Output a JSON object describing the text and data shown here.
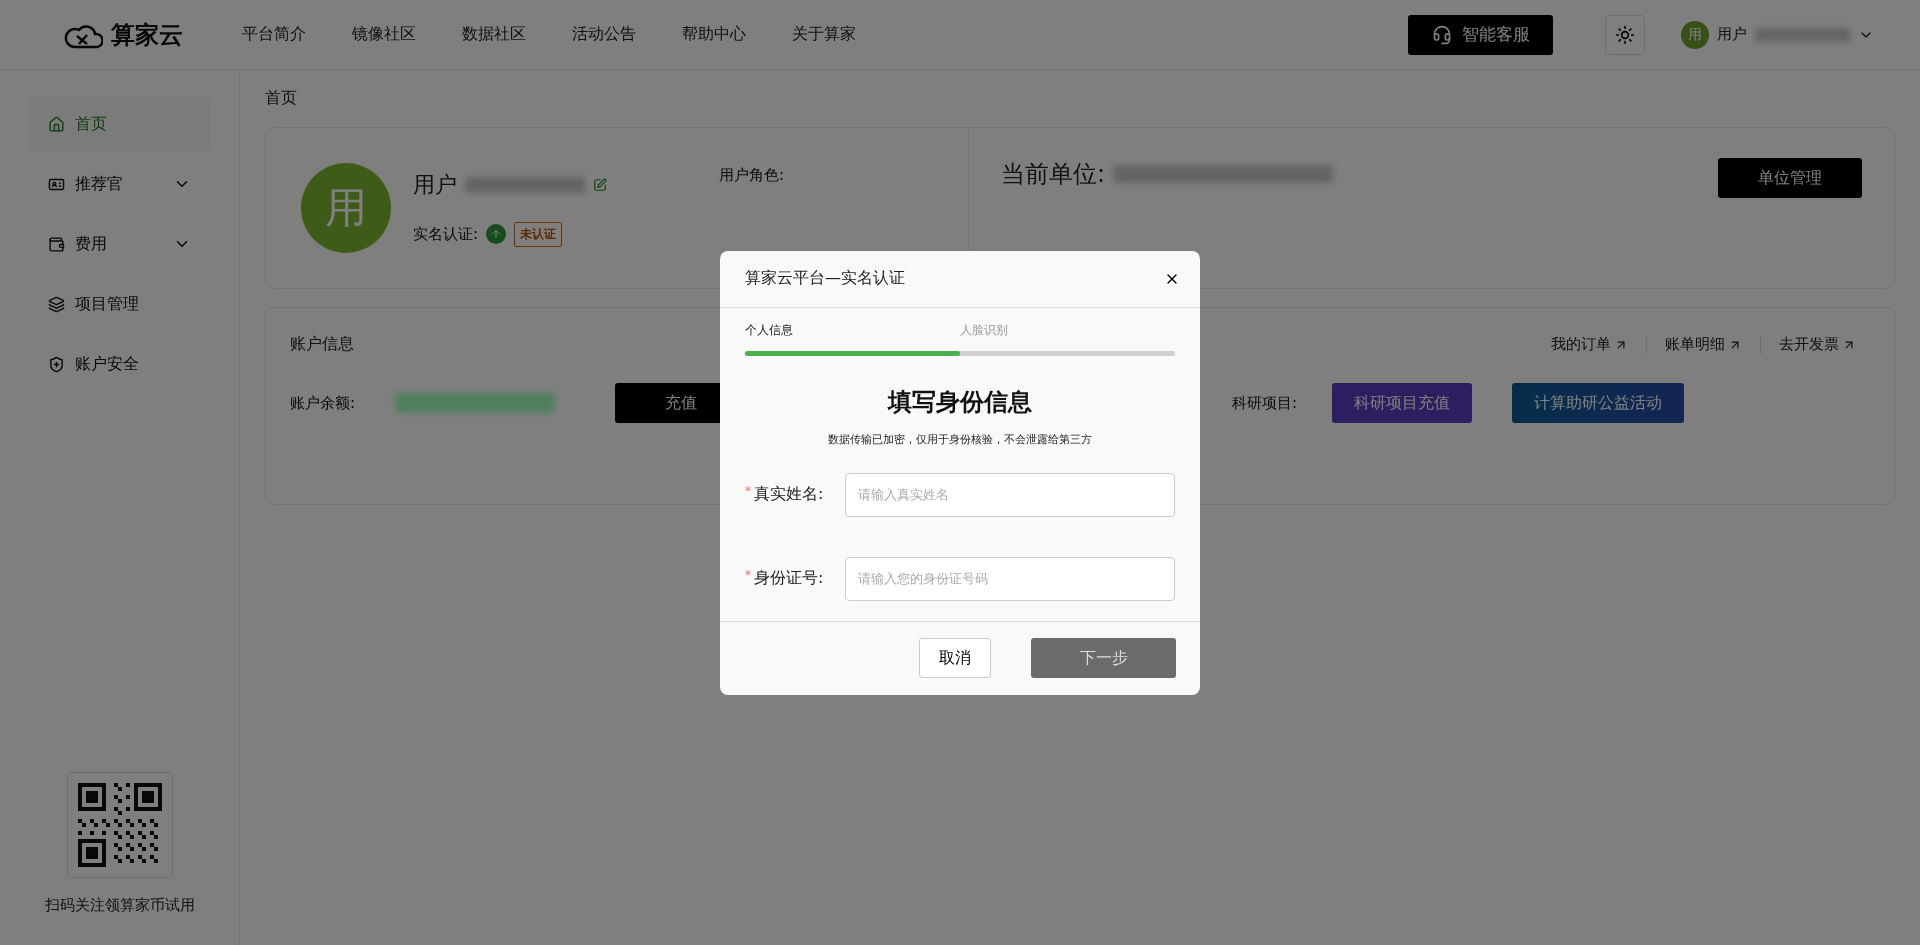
{
  "header": {
    "logo": "算家云",
    "nav": [
      "平台简介",
      "镜像社区",
      "数据社区",
      "活动公告",
      "帮助中心",
      "关于算家"
    ],
    "service_button": "智能客服",
    "user": {
      "avatar": "用",
      "name": "用户"
    }
  },
  "sidebar": {
    "items": [
      {
        "label": "首页",
        "selected": true,
        "collapsible": false
      },
      {
        "label": "推荐官",
        "selected": false,
        "collapsible": true
      },
      {
        "label": "费用",
        "selected": false,
        "collapsible": true
      },
      {
        "label": "项目管理",
        "selected": false,
        "collapsible": false
      },
      {
        "label": "账户安全",
        "selected": false,
        "collapsible": false
      }
    ],
    "qr_caption": "扫码关注领算家币试用"
  },
  "breadcrumb": "首页",
  "profile": {
    "avatar": "用",
    "name": "用户",
    "verify_label": "实名认证:",
    "verify_status": "未认证",
    "role_label": "用户角色:",
    "unit_label": "当前单位:",
    "unit_button": "单位管理"
  },
  "account": {
    "title": "账户信息",
    "links": [
      "我的订单",
      "账单明细",
      "去开发票"
    ],
    "balance_label": "账户余额:",
    "recharge_button": "充值",
    "project_label": "科研项目:",
    "project_buttons": [
      {
        "label": "科研项目充值",
        "kind": "solid"
      },
      {
        "label": "计算助研公益活动",
        "kind": "gradient"
      }
    ]
  },
  "modal": {
    "title": "算家云平台—实名认证",
    "steps": [
      {
        "label": "个人信息",
        "selected": true
      },
      {
        "label": "人脸识别",
        "selected": false
      }
    ],
    "progress": {
      "level": 0.5
    },
    "heading": "填写身份信息",
    "subtitle": "数据传输已加密，仅用于身份核验，不会泄露给第三方",
    "fields": [
      {
        "label": "真实姓名:",
        "placeholder": "请输入真实姓名",
        "required": true,
        "required_mark": "*"
      },
      {
        "label": "身份证号:",
        "placeholder": "请输入您的身份证号码",
        "required": true,
        "required_mark": "*"
      }
    ],
    "cancel": "取消",
    "next": "下一步"
  }
}
